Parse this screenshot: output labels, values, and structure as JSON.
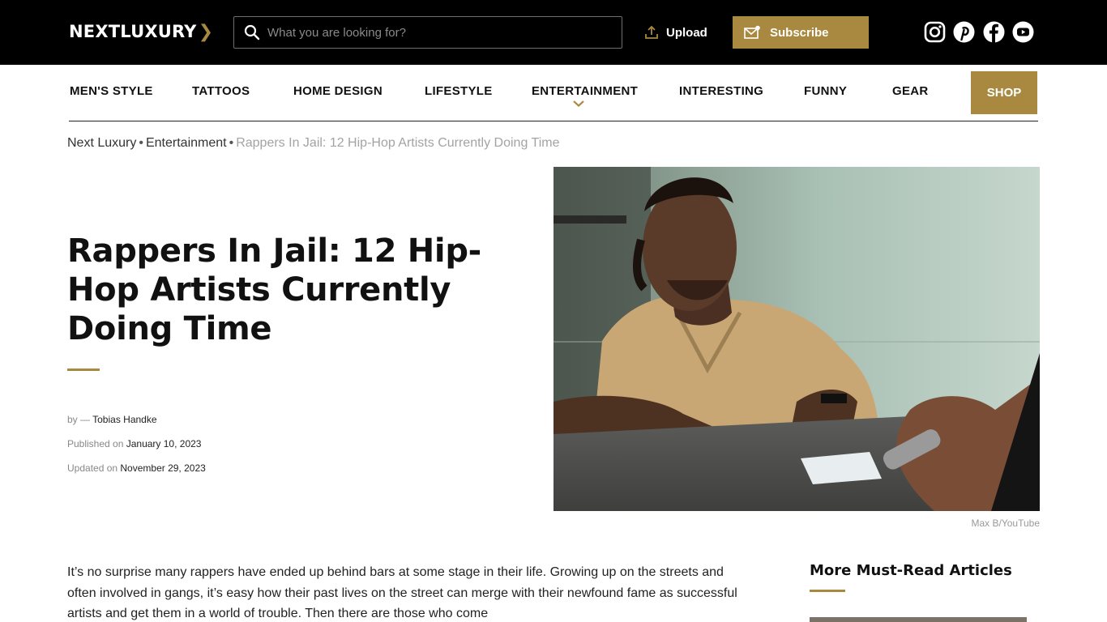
{
  "header": {
    "logo": {
      "text": "NEXTLUXURY",
      "chevron": "❯"
    },
    "search": {
      "placeholder": "What you are looking for?",
      "value": "",
      "icon": "search-icon"
    },
    "upload_label": "Upload",
    "subscribe_label": "Subscribe",
    "social": [
      "instagram-icon",
      "pinterest-icon",
      "facebook-icon",
      "youtube-icon"
    ]
  },
  "nav": {
    "items": [
      "MEN'S STYLE",
      "TATTOOS",
      "HOME DESIGN",
      "LIFESTYLE",
      "ENTERTAINMENT",
      "INTERESTING",
      "FUNNY",
      "GEAR"
    ],
    "shop_label": "SHOP"
  },
  "breadcrumb": {
    "items": [
      "Next Luxury",
      "Entertainment"
    ],
    "separator": "•",
    "current": "Rappers In Jail: 12 Hip-Hop Artists Currently Doing Time"
  },
  "article": {
    "title": "Rappers In Jail: 12 Hip-Hop Artists Currently Doing Time",
    "author_prefix": "by — ",
    "author": "Tobias Handke",
    "published_label": "Published on ",
    "published_date": "January 10, 2023",
    "updated_label": "Updated on ",
    "updated_date": "November 29, 2023",
    "image_caption": "Max B/YouTube",
    "intro": "It’s no surprise many rappers have ended up behind bars at some stage in their life. Growing up on the streets and often involved in gangs, it’s easy how their past lives on the street can merge with their newfound fame as successful artists and get them in a world of trouble. Then there are those who come"
  },
  "sidebar": {
    "title": "More Must-Read Articles"
  },
  "colors": {
    "accent": "#a8893f",
    "topbar": "#000000"
  }
}
